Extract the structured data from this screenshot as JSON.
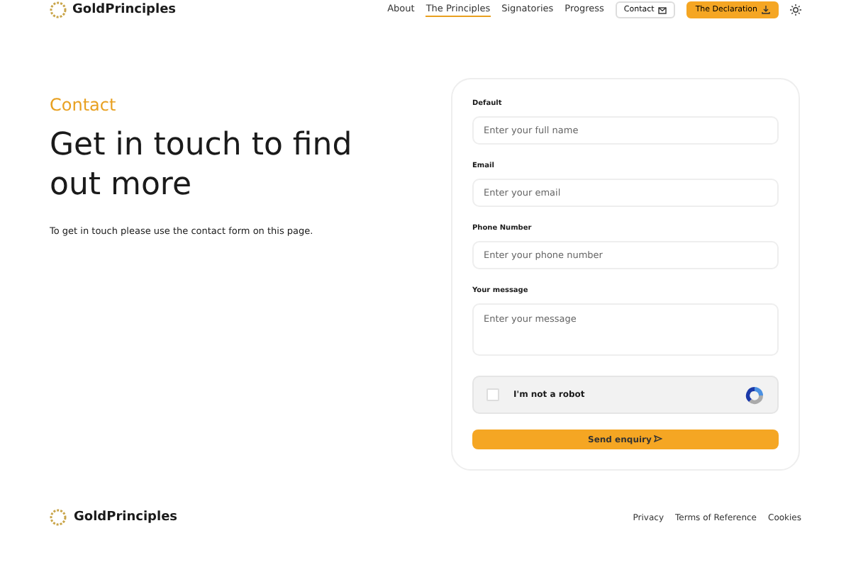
{
  "header": {
    "logo": "GoldPrinciples",
    "nav": [
      {
        "label": "About",
        "selected": false
      },
      {
        "label": "The Principles",
        "selected": true
      },
      {
        "label": "Signatories",
        "selected": false
      },
      {
        "label": "Progress",
        "selected": false
      }
    ],
    "contact_button": "Contact",
    "declaration_button": "The Declaration"
  },
  "intro": {
    "eyebrow": "Contact",
    "heading": "Get in touch to find out more",
    "text": "To get in touch please use the contact form on this page."
  },
  "form": {
    "fields": [
      {
        "kind": "input",
        "label": "Default",
        "placeholder": "Enter your full name"
      },
      {
        "kind": "input",
        "label": "Email",
        "placeholder": "Enter your email"
      },
      {
        "kind": "input",
        "label": "Phone Number",
        "placeholder": "Enter your phone number"
      },
      {
        "kind": "textarea",
        "label": "Your message",
        "placeholder": "Enter your message"
      }
    ],
    "captcha": {
      "label": "I'm not a robot",
      "checked": false
    },
    "submit": "Send enquiry"
  },
  "footer": {
    "logo": "GoldPrinciples",
    "links": [
      "Privacy",
      "Terms of Reference",
      "Cookies"
    ]
  }
}
